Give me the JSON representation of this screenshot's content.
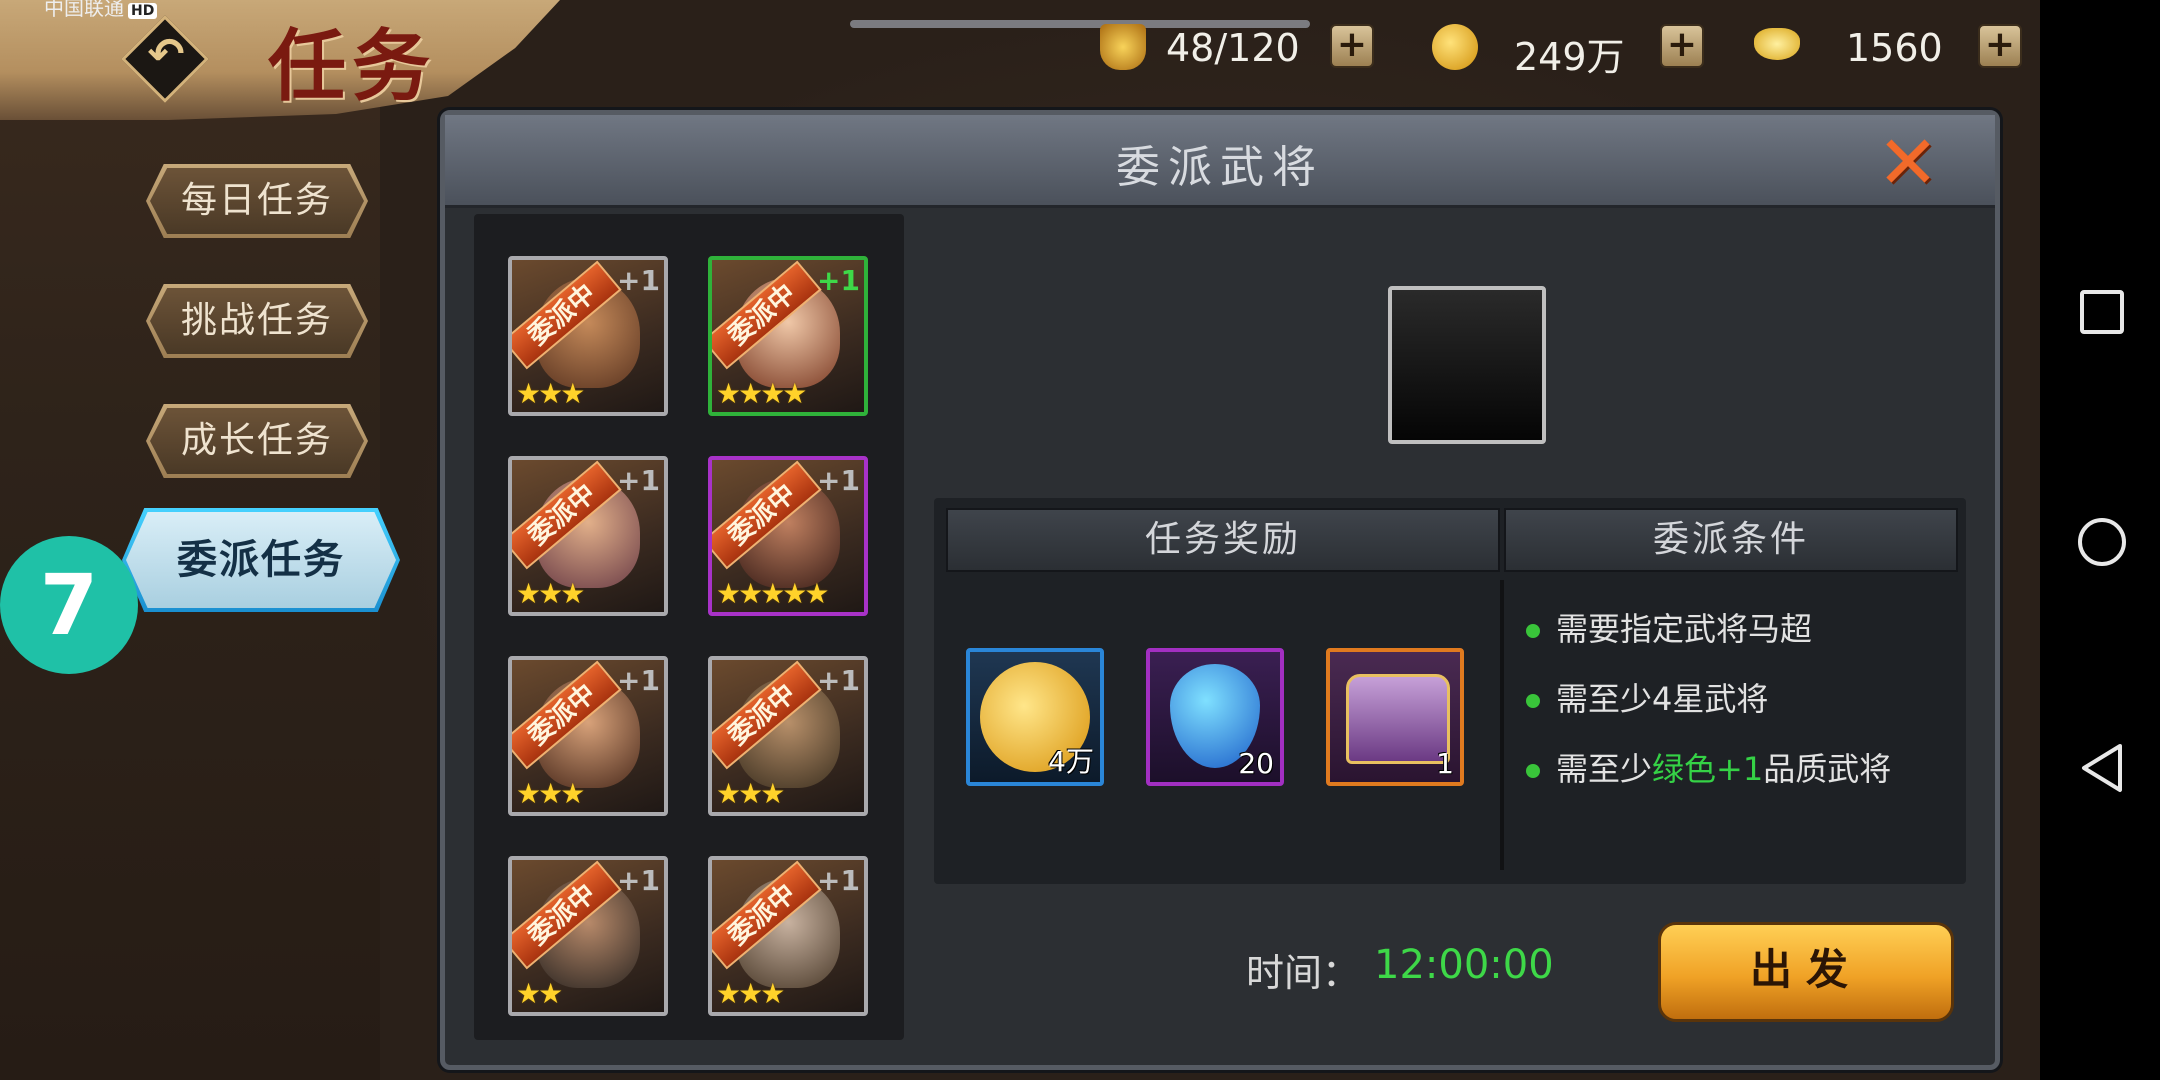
{
  "status_bar": {
    "carrier": "中国联通",
    "hd": "HD"
  },
  "header": {
    "title": "任务",
    "back_icon": "back-arrow-icon",
    "resources": [
      {
        "icon": "stamina-icon",
        "value": "48/120",
        "color": "#e0a928"
      },
      {
        "icon": "gold-coin-icon",
        "value": "249万",
        "color": "#f2c12c"
      },
      {
        "icon": "ingot-icon",
        "value": "1560",
        "color": "#f5cf5a"
      }
    ],
    "plus_label": "+"
  },
  "tabs": [
    {
      "label": "每日任务",
      "active": false
    },
    {
      "label": "挑战任务",
      "active": false
    },
    {
      "label": "成长任务",
      "active": false
    },
    {
      "label": "委派任务",
      "active": true
    }
  ],
  "badge": {
    "label": "7"
  },
  "modal": {
    "title": "委派武将",
    "close_icon": "close-x-icon",
    "heroes": [
      {
        "tag": "委派中",
        "plus": "+1",
        "stars": "★★★",
        "border": "#a9a9ad",
        "plus_color": "#bcbcbc"
      },
      {
        "tag": "委派中",
        "plus": "+1",
        "stars": "★★★★",
        "border": "#2fb23a",
        "plus_color": "#3ed848"
      },
      {
        "tag": "委派中",
        "plus": "+1",
        "stars": "★★★",
        "border": "#a9a9ad",
        "plus_color": "#bcbcbc"
      },
      {
        "tag": "委派中",
        "plus": "+1",
        "stars": "★★★★★",
        "border": "#a832c8",
        "plus_color": "#bcbcbc"
      },
      {
        "tag": "委派中",
        "plus": "+1",
        "stars": "★★★",
        "border": "#a9a9ad",
        "plus_color": "#bcbcbc"
      },
      {
        "tag": "委派中",
        "plus": "+1",
        "stars": "★★★",
        "border": "#a9a9ad",
        "plus_color": "#bcbcbc"
      },
      {
        "tag": "委派中",
        "plus": "+1",
        "stars": "★★",
        "border": "#a9a9ad",
        "plus_color": "#bcbcbc"
      },
      {
        "tag": "委派中",
        "plus": "+1",
        "stars": "★★★",
        "border": "#a9a9ad",
        "plus_color": "#bcbcbc"
      }
    ],
    "reward_header": "任务奖励",
    "condition_header": "委派条件",
    "rewards": [
      {
        "icon": "gold-coin-icon",
        "count": "4万",
        "border": "#2a86d8"
      },
      {
        "icon": "energy-gem-icon",
        "count": "20",
        "border": "#a22fc2"
      },
      {
        "icon": "treasure-chest-icon",
        "count": "1",
        "border": "#e07a1f"
      }
    ],
    "conditions": {
      "c1": "需要指定武将马超",
      "c2": "需至少4星武将",
      "c3_pre": "需至少",
      "c3_green": "绿色+1",
      "c3_post": "品质武将"
    },
    "time_label": "时间：",
    "time_value": "12:00:00",
    "go_button": "出发"
  },
  "system_nav": {
    "recent": "square-icon",
    "home": "circle-icon",
    "back": "triangle-back-icon"
  }
}
